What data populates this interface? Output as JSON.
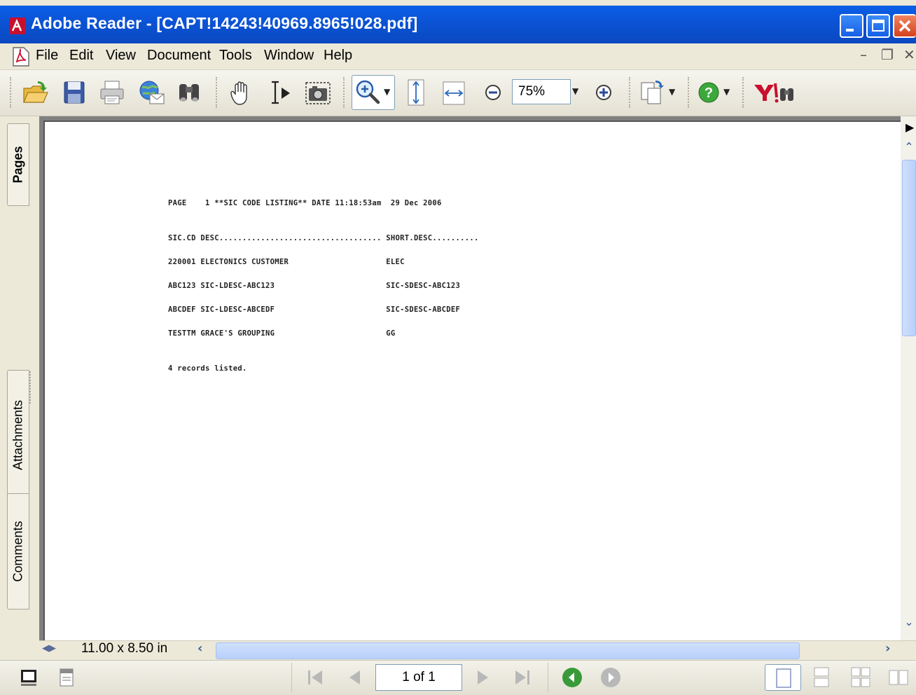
{
  "window": {
    "title": "Adobe Reader - [CAPT!14243!40969.8965!028.pdf]"
  },
  "menu": {
    "items": [
      "File",
      "Edit",
      "View",
      "Document",
      "Tools",
      "Window",
      "Help"
    ]
  },
  "toolbar": {
    "zoom_value": "75%",
    "icons": [
      "open-icon",
      "save-icon",
      "print-icon",
      "email-icon",
      "search-icon",
      "hand-tool-icon",
      "select-text-icon",
      "snapshot-icon",
      "zoom-in-tool-icon",
      "fit-page-icon",
      "fit-width-icon",
      "zoom-out-icon",
      "zoom-in-icon",
      "rotate-pages-icon",
      "help-icon",
      "yahoo-search-icon"
    ]
  },
  "nav_tabs": [
    "Pages",
    "Attachments",
    "Comments"
  ],
  "document": {
    "lines": [
      "PAGE    1 **SIC CODE LISTING** DATE 11:18:53am  29 Dec 2006",
      "SIC.CD DESC................................... SHORT.DESC..........",
      "220001 ELECTONICS CUSTOMER                     ELEC",
      "ABC123 SIC-LDESC-ABC123                        SIC-SDESC-ABC123",
      "ABCDEF SIC-LDESC-ABCEDF                        SIC-SDESC-ABCDEF",
      "TESTTM GRACE'S GROUPING                        GG",
      "4 records listed."
    ]
  },
  "status": {
    "page_size": "11.00 x 8.50 in",
    "page_indicator": "1 of 1"
  },
  "colors": {
    "titlebar": "#0a54d6",
    "chrome": "#ece9d8",
    "scroll_thumb": "#c2d6fc",
    "close_button": "#e05a30"
  }
}
